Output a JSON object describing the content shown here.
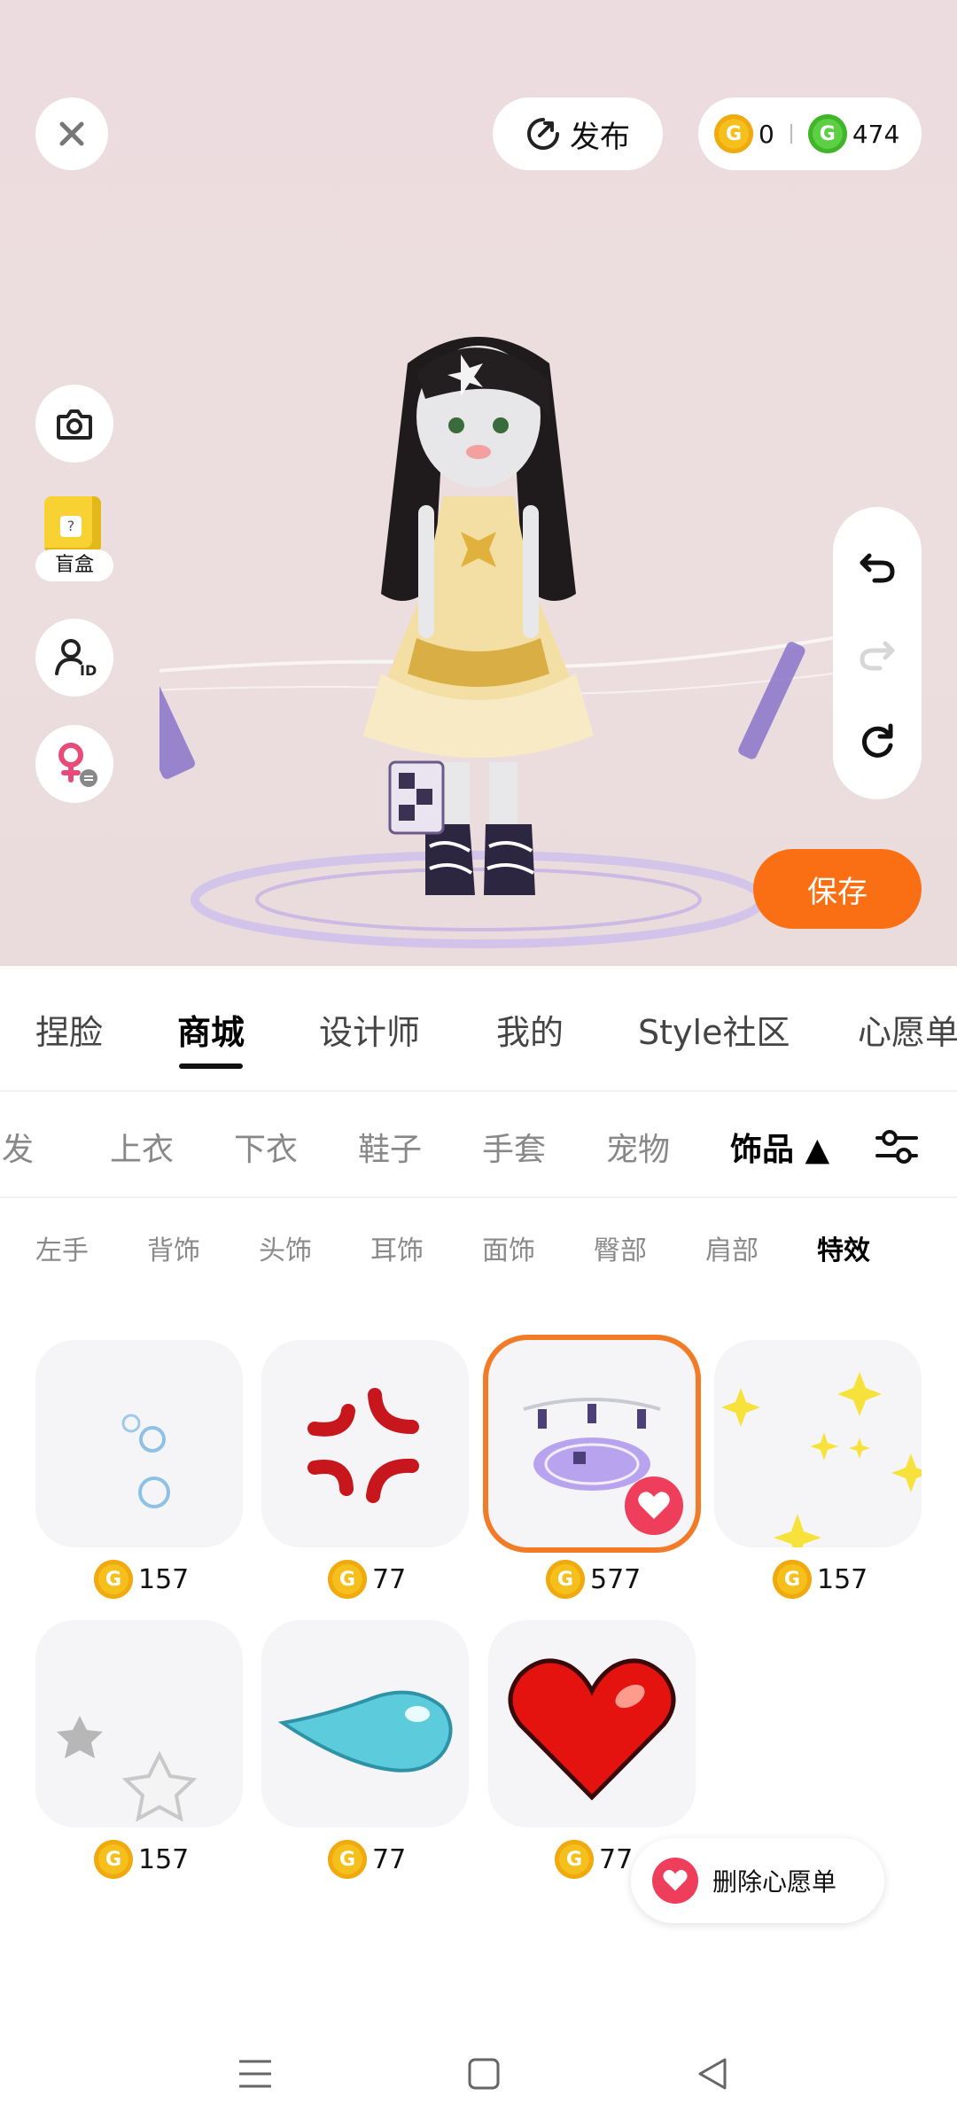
{
  "header": {
    "publish_label": "发布",
    "gold_balance": "0",
    "green_balance": "474",
    "gold_coin_letter": "G",
    "green_coin_letter": "G"
  },
  "side_tools": {
    "blind_box_label": "盲盒"
  },
  "save_label": "保存",
  "main_tabs": [
    {
      "label": "捏脸"
    },
    {
      "label": "商城",
      "active": true
    },
    {
      "label": "设计师"
    },
    {
      "label": "我的"
    },
    {
      "label": "Style社区"
    },
    {
      "label": "心愿单"
    }
  ],
  "category_tabs": [
    {
      "label": "头发"
    },
    {
      "label": "上衣"
    },
    {
      "label": "下衣"
    },
    {
      "label": "鞋子"
    },
    {
      "label": "手套"
    },
    {
      "label": "宠物"
    },
    {
      "label": "饰品 ▲",
      "active": true
    }
  ],
  "sub_tabs": [
    {
      "label": "左手"
    },
    {
      "label": "背饰"
    },
    {
      "label": "头饰"
    },
    {
      "label": "耳饰"
    },
    {
      "label": "面饰"
    },
    {
      "label": "臀部"
    },
    {
      "label": "肩部"
    },
    {
      "label": "特效",
      "active": true
    }
  ],
  "items": [
    {
      "icon": "bubbles-effect-icon",
      "price": "157"
    },
    {
      "icon": "anger-mark-effect-icon",
      "price": "77"
    },
    {
      "icon": "purple-magic-circle-effect-icon",
      "price": "577",
      "selected": true,
      "wishlisted": true
    },
    {
      "icon": "yellow-sparkles-effect-icon",
      "price": "157"
    },
    {
      "icon": "grey-stars-effect-icon",
      "price": "157"
    },
    {
      "icon": "blue-water-drop-effect-icon",
      "price": "77"
    },
    {
      "icon": "red-heart-effect-icon",
      "price": "77"
    }
  ],
  "wishlist_toast": {
    "label": "删除心愿单"
  },
  "colors": {
    "accent_orange": "#fb6f14",
    "selected_border": "#f27b27",
    "gold_coin": "#f5c01b",
    "green_coin": "#5ccf43",
    "wishlist_heart": "#ef3e5c"
  }
}
